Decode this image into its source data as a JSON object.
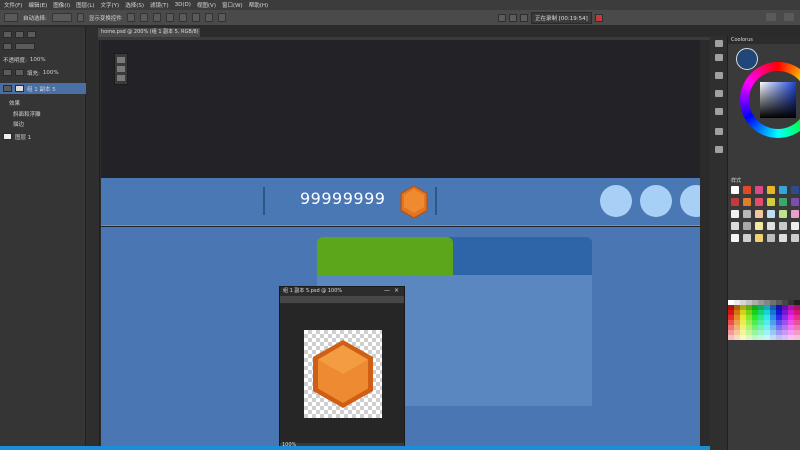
{
  "menubar": {
    "items": [
      "文件(F)",
      "编辑(E)",
      "图像(I)",
      "图层(L)",
      "文字(Y)",
      "选择(S)",
      "滤镜(T)",
      "3D(D)",
      "视图(V)",
      "窗口(W)",
      "帮助(H)"
    ]
  },
  "optbar": {
    "auto_select_label": "自动选择:",
    "transform_label": "显示变换控件"
  },
  "workspace": {
    "label": "正在录制 [00:19:54]"
  },
  "layers_panel": {
    "opacity_label": "不透明度:",
    "opacity_value": "100%",
    "fill_label": "填充:",
    "fill_value": "100%",
    "rows": [
      "组 1 副本 5",
      "效果",
      "斜面和浮雕",
      "描边",
      "图层 1"
    ]
  },
  "document": {
    "tab_title": "home.psd @ 200% (组 1 副本 5, RGB/8)"
  },
  "canvas": {
    "score": "99999999",
    "circle_count": 3
  },
  "float_window": {
    "title": "组 1 副本 5.psd @ 100%",
    "min_label": "—",
    "close_label": "×",
    "zoom": "100%"
  },
  "right_panel": {
    "color_tab": "Coolorus",
    "swatches_tab": "样式",
    "fg_color": "#20467a",
    "swatch_colors": [
      "#ffffff",
      "#e3472a",
      "#d94a8a",
      "#e6b52a",
      "#37a3d8",
      "#2e4b8f",
      "#c23a3a",
      "#e07d2b",
      "#e84a6e",
      "#d4cc3a",
      "#3aa86b",
      "#7a4fb0",
      "#f0f0f0",
      "#b8b8b8",
      "#f0c8a0",
      "#c0dcf0",
      "#bfe28a",
      "#e8a0c8",
      "#dcdcdc",
      "#a8a8a8",
      "#f3e8a0",
      "#e0e0e0",
      "#c8c8c8",
      "#eeeeee",
      "#f5f5f5",
      "#d0d0d0",
      "#f0d070",
      "#bcbcbc",
      "#dedede",
      "#cccccc"
    ]
  }
}
